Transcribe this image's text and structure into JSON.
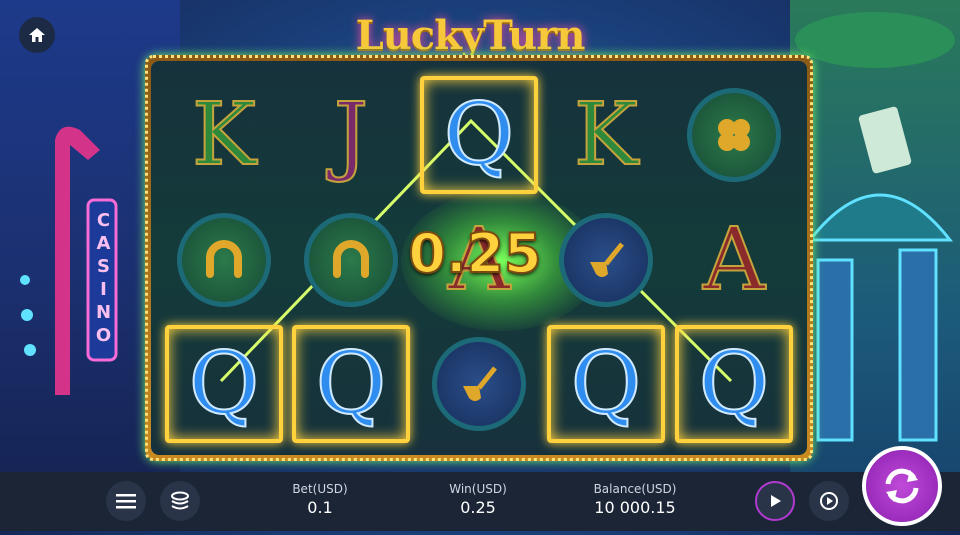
{
  "game": {
    "title": "LuckyTurn"
  },
  "win_amount": "0.25",
  "reels": [
    [
      "K",
      "K-win-no",
      "J",
      "Q",
      "K",
      "coin"
    ]
  ],
  "grid": [
    [
      {
        "symbol": "K",
        "type": "letter",
        "win": false
      },
      {
        "symbol": "J",
        "type": "letter",
        "win": false
      },
      {
        "symbol": "Q",
        "type": "letter",
        "win": true
      },
      {
        "symbol": "K",
        "type": "letter",
        "win": false
      },
      {
        "symbol": "clover",
        "type": "coin",
        "win": false
      }
    ],
    [
      {
        "symbol": "horseshoe",
        "type": "coin",
        "win": false
      },
      {
        "symbol": "horseshoe",
        "type": "coin",
        "win": false
      },
      {
        "symbol": "A",
        "type": "letter",
        "win": false
      },
      {
        "symbol": "pipe",
        "type": "coin",
        "win": false
      },
      {
        "symbol": "A",
        "type": "letter",
        "win": false
      }
    ],
    [
      {
        "symbol": "Q",
        "type": "letter",
        "win": true
      },
      {
        "symbol": "Q",
        "type": "letter",
        "win": true
      },
      {
        "symbol": "pipe",
        "type": "coin",
        "win": false
      },
      {
        "symbol": "Q",
        "type": "letter",
        "win": true
      },
      {
        "symbol": "Q",
        "type": "letter",
        "win": true
      }
    ]
  ],
  "bet": {
    "label": "Bet(USD)",
    "value": "0.1"
  },
  "win": {
    "label": "Win(USD)",
    "value": "0.25"
  },
  "balance": {
    "label": "Balance(USD)",
    "value": "10 000.15"
  },
  "signs": {
    "casino": "CASINO"
  },
  "colors": {
    "accent": "#ffd23d",
    "spin": "#a032c8",
    "bar": "#1b2536"
  }
}
